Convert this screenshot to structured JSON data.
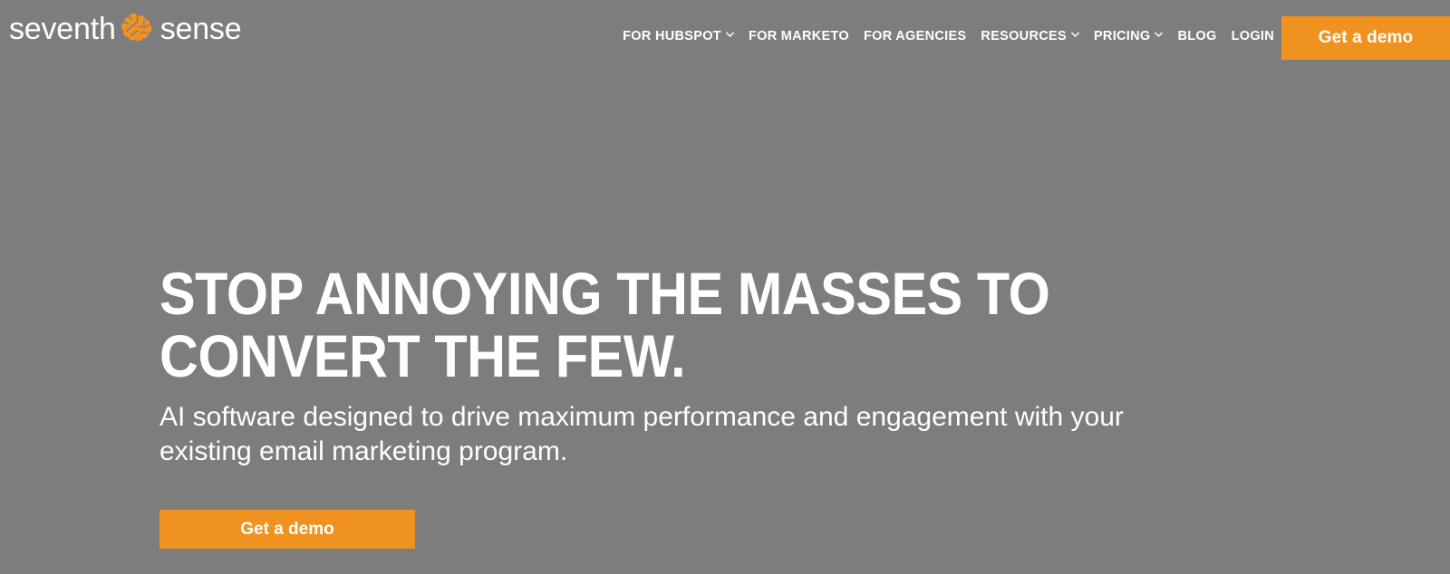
{
  "theme": {
    "background": "#7d7d7d",
    "accent": "#f0921f",
    "text_on_dark": "#ffffff"
  },
  "header": {
    "logo": {
      "word_one": "seventh",
      "word_two": "sense",
      "icon": "brain-icon",
      "icon_color": "#f0921f"
    },
    "nav": [
      {
        "label": "FOR HUBSPOT",
        "has_dropdown": true
      },
      {
        "label": "FOR MARKETO",
        "has_dropdown": false
      },
      {
        "label": "FOR AGENCIES",
        "has_dropdown": false
      },
      {
        "label": "RESOURCES",
        "has_dropdown": true
      },
      {
        "label": "PRICING",
        "has_dropdown": true
      },
      {
        "label": "BLOG",
        "has_dropdown": false
      },
      {
        "label": "LOGIN",
        "has_dropdown": false
      }
    ],
    "cta_label": "Get a demo"
  },
  "hero": {
    "headline": "Stop annoying the masses to convert the few.",
    "subheadline": "AI software designed to drive maximum performance and engagement with your existing email marketing program.",
    "cta_label": "Get a demo"
  }
}
